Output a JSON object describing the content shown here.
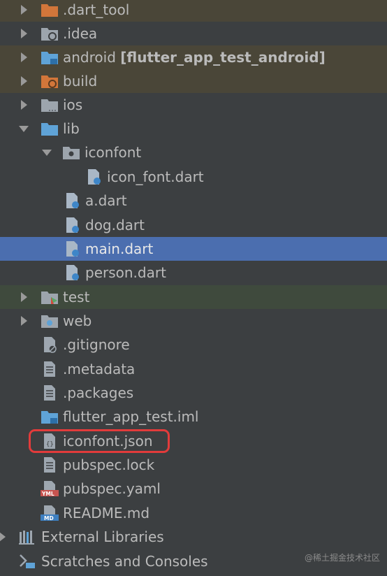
{
  "colors": {
    "background": "#3c3f41",
    "selected_row": "#4b6eaf",
    "excluded_row": "#4a4638",
    "test_row": "#3f4a3d",
    "highlight_box": "#e23b3b",
    "folder_blue": "#5fa3d7",
    "folder_orange": "#d2763a"
  },
  "tree": {
    "dart_tool": ".dart_tool",
    "idea": ".idea",
    "android_name": "android",
    "android_module": "[flutter_app_test_android]",
    "build": "build",
    "ios": "ios",
    "lib": "lib",
    "iconfont_folder": "iconfont",
    "icon_font_dart": "icon_font.dart",
    "a_dart": "a.dart",
    "dog_dart": "dog.dart",
    "main_dart": "main.dart",
    "person_dart": "person.dart",
    "test": "test",
    "web": "web",
    "gitignore": ".gitignore",
    "metadata": ".metadata",
    "packages": ".packages",
    "iml": "flutter_app_test.iml",
    "iconfont_json": "iconfont.json",
    "pubspec_lock": "pubspec.lock",
    "pubspec_yaml": "pubspec.yaml",
    "readme": "README.md",
    "external_libraries": "External Libraries",
    "scratches": "Scratches and Consoles"
  },
  "icon_labels": {
    "yml": "YML",
    "md": "MD"
  },
  "watermark": "@稀土掘金技术社区"
}
